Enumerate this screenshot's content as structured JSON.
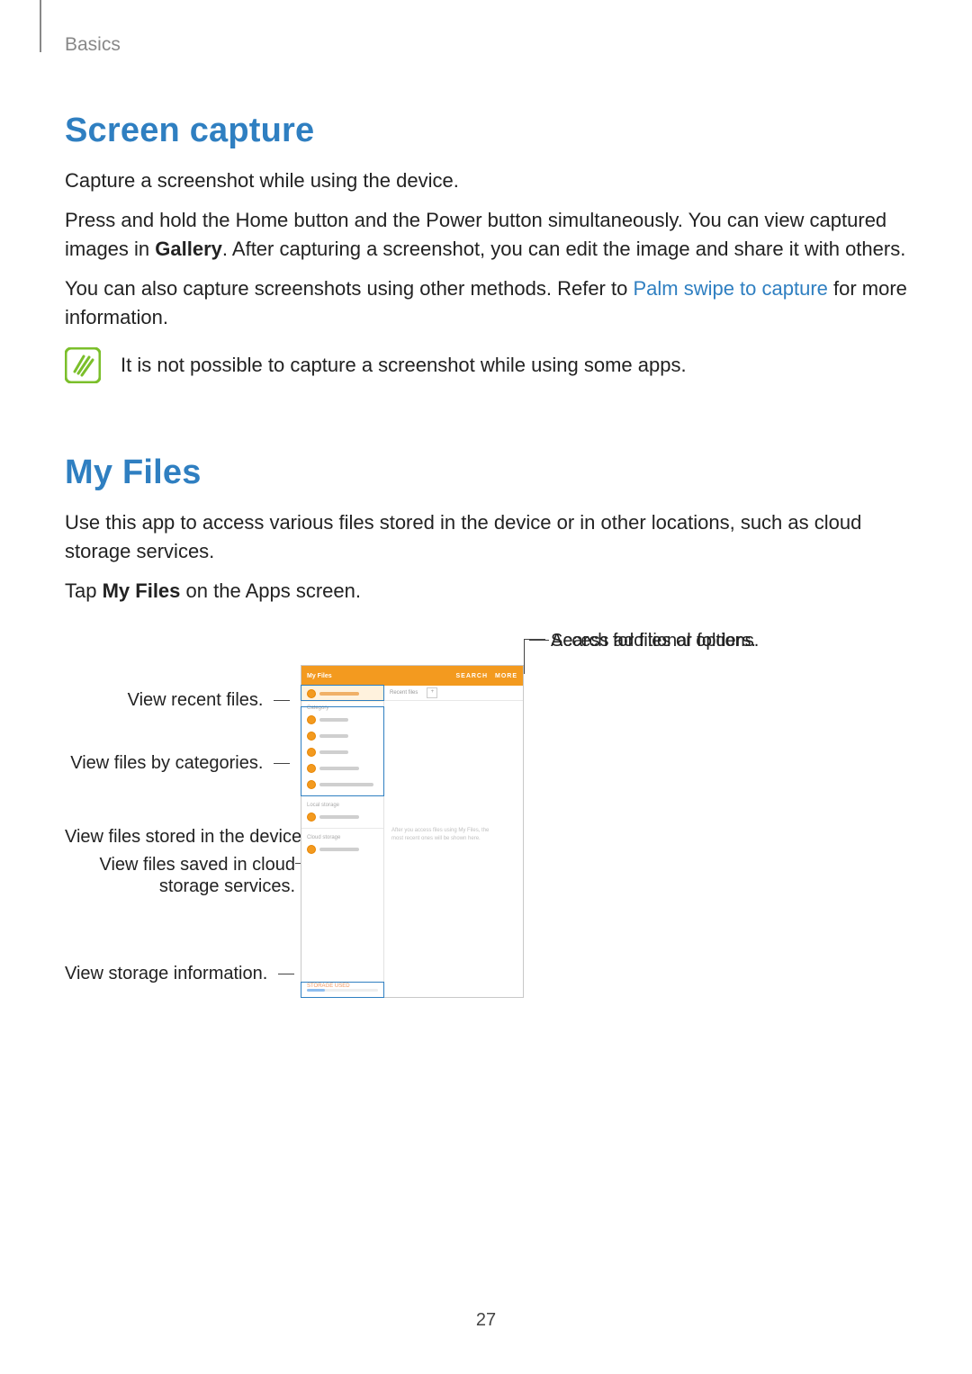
{
  "breadcrumb": "Basics",
  "page_number": "27",
  "sections": {
    "screen_capture": {
      "heading": "Screen capture",
      "p1": "Capture a screenshot while using the device.",
      "p2a": "Press and hold the Home button and the Power button simultaneously. You can view captured images in ",
      "p2_bold": "Gallery",
      "p2b": ". After capturing a screenshot, you can edit the image and share it with others.",
      "p3a": "You can also capture screenshots using other methods. Refer to ",
      "p3_link": "Palm swipe to capture",
      "p3b": " for more information.",
      "note": "It is not possible to capture a screenshot while using some apps."
    },
    "my_files": {
      "heading": "My Files",
      "p1": "Use this app to access various files stored in the device or in other locations, such as cloud storage services.",
      "p2a": "Tap ",
      "p2_bold": "My Files",
      "p2b": " on the Apps screen."
    }
  },
  "callouts": {
    "search": "Search for files or folders.",
    "more": "Access additional options.",
    "recent": "View recent files.",
    "categories": "View files by categories.",
    "device": "View files stored in the device.",
    "cloud_l1": "View files saved in cloud",
    "cloud_l2": "storage services.",
    "storage": "View storage information."
  },
  "device": {
    "title": "My Files",
    "search_label": "SEARCH",
    "more_label": "MORE",
    "recent_tab": "Recent files",
    "plus": "+",
    "section_category": "Category",
    "section_local": "Local storage",
    "section_cloud": "Cloud storage",
    "storage_used": "STORAGE USED",
    "empty_l1": "After you access files using My Files, the",
    "empty_l2": "most recent ones will be shown here."
  }
}
